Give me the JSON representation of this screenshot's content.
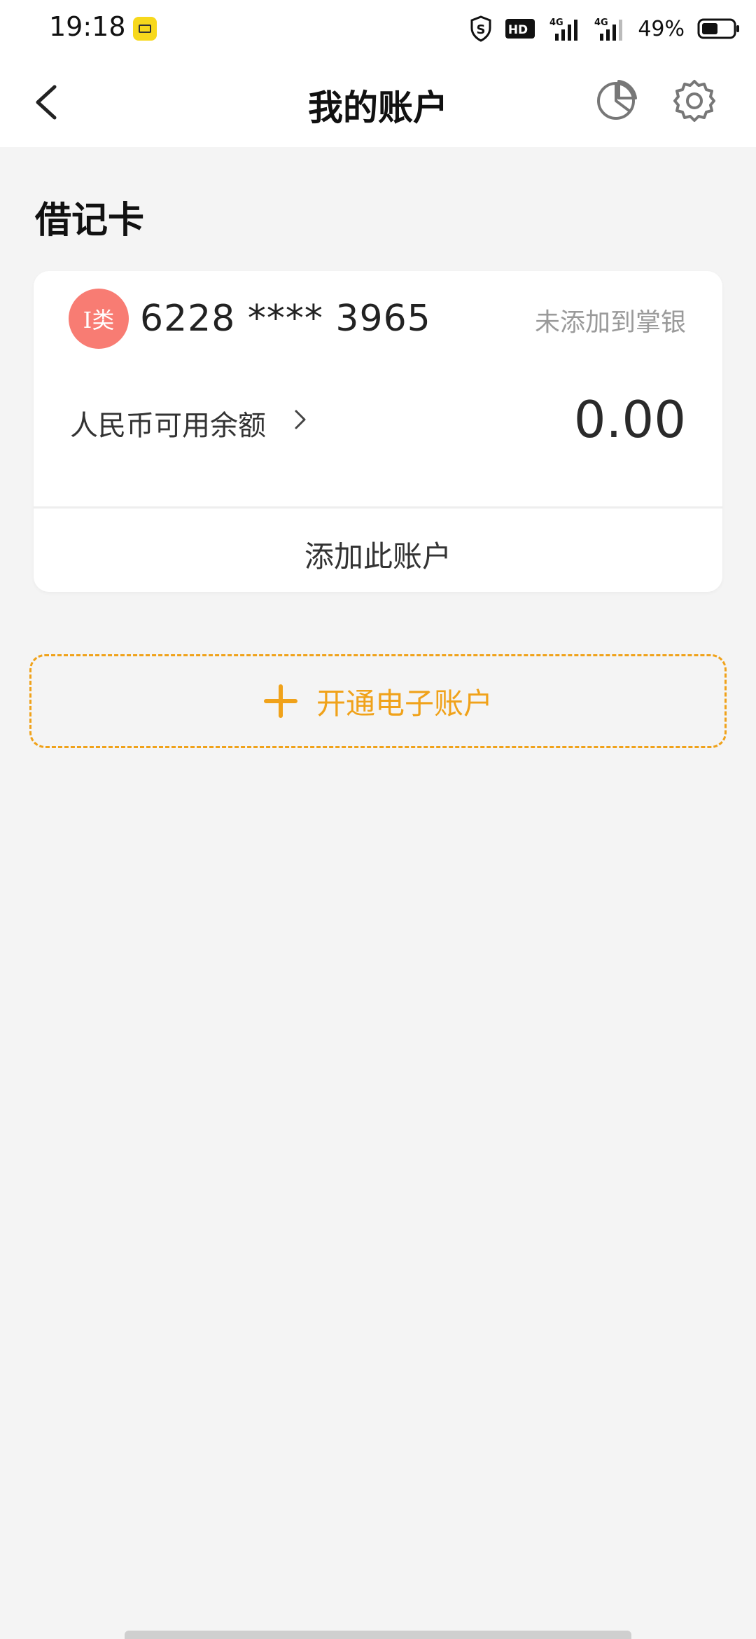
{
  "status_bar": {
    "time": "19:18",
    "signal_labels": [
      "4G",
      "4G"
    ],
    "hd_label": "HD",
    "battery": "49%"
  },
  "header": {
    "title": "我的账户"
  },
  "section": {
    "title": "借记卡"
  },
  "card": {
    "badge": "I类",
    "number": "6228 **** 3965",
    "status": "未添加到掌银",
    "balance_label": "人民币可用余额",
    "balance_value": "0.00",
    "add_label": "添加此账户"
  },
  "open_eaccount": {
    "label": "开通电子账户"
  },
  "colors": {
    "accent": "#f0a21a",
    "badge": "#f87c73",
    "background": "#f4f4f4"
  }
}
